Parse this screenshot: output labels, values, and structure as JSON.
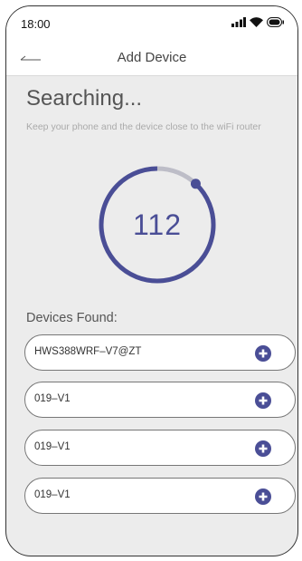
{
  "status_bar": {
    "time": "18:00"
  },
  "header": {
    "title": "Add Device"
  },
  "search": {
    "heading": "Searching...",
    "hint": "Keep your phone and the device close to the wiFi router",
    "countdown": "112",
    "progress_fraction": 0.12
  },
  "devices_section": {
    "label": "Devices Found:",
    "items": [
      {
        "name": "HWS388WRF–V7@ZT"
      },
      {
        "name": "019–V1"
      },
      {
        "name": "019–V1"
      },
      {
        "name": "019–V1"
      }
    ]
  },
  "colors": {
    "accent": "#4a4e96",
    "progress_track": "#bdbdc7",
    "background": "#ececec"
  },
  "icons": {
    "back": "back-arrow-icon",
    "signal": "cellular-signal-icon",
    "wifi": "wifi-icon",
    "battery": "battery-icon",
    "add": "plus-circle-icon"
  }
}
